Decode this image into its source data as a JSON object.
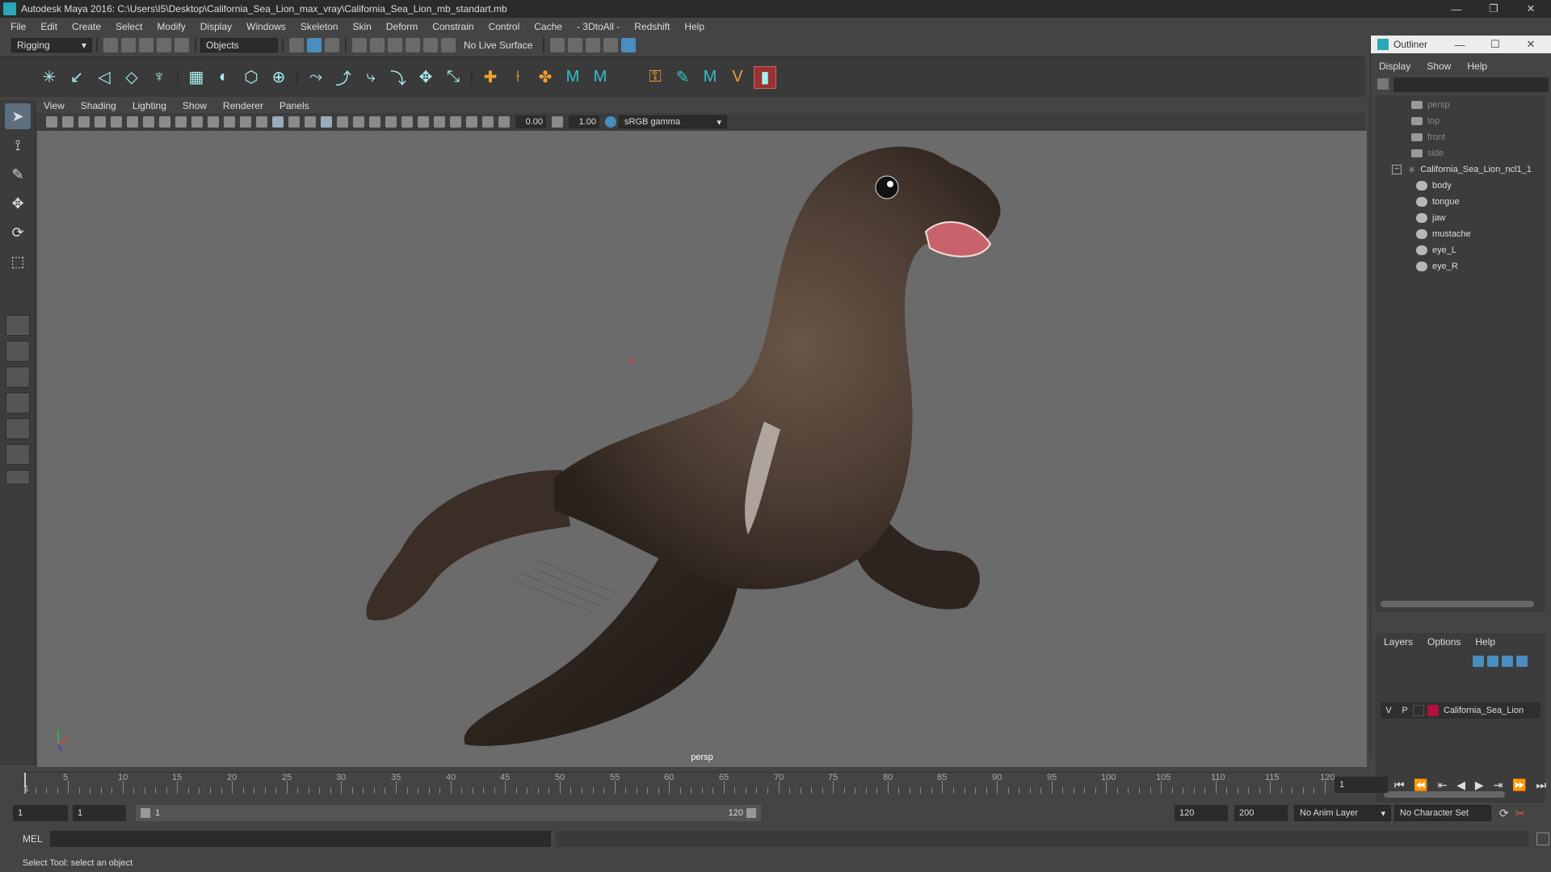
{
  "window": {
    "title": "Autodesk Maya 2016: C:\\Users\\I5\\Desktop\\California_Sea_Lion_max_vray\\California_Sea_Lion_mb_standart.mb"
  },
  "menubar": {
    "items": [
      "File",
      "Edit",
      "Create",
      "Select",
      "Modify",
      "Display",
      "Windows",
      "Skeleton",
      "Skin",
      "Deform",
      "Constrain",
      "Control",
      "Cache",
      "- 3DtoAll -",
      "Redshift",
      "Help"
    ]
  },
  "statusline": {
    "mode": "Rigging",
    "selection_mask": "Objects",
    "live_surface": "No Live Surface"
  },
  "viewport": {
    "menu": [
      "View",
      "Shading",
      "Lighting",
      "Show",
      "Renderer",
      "Panels"
    ],
    "exposure": "0.00",
    "gamma": "1.00",
    "color_space": "sRGB gamma",
    "camera_label": "persp"
  },
  "outliner": {
    "title": "Outliner",
    "menu": [
      "Display",
      "Show",
      "Help"
    ],
    "items": [
      {
        "label": "persp",
        "type": "camera"
      },
      {
        "label": "top",
        "type": "camera"
      },
      {
        "label": "front",
        "type": "camera"
      },
      {
        "label": "side",
        "type": "camera"
      },
      {
        "label": "California_Sea_Lion_ncl1_1",
        "type": "group"
      },
      {
        "label": "body",
        "type": "mesh"
      },
      {
        "label": "tongue",
        "type": "mesh"
      },
      {
        "label": "jaw",
        "type": "mesh"
      },
      {
        "label": "mustache",
        "type": "mesh"
      },
      {
        "label": "eye_L",
        "type": "mesh"
      },
      {
        "label": "eye_R",
        "type": "mesh"
      }
    ]
  },
  "layers": {
    "menu": [
      "Layers",
      "Options",
      "Help"
    ],
    "rows": [
      {
        "v": "V",
        "p": "P",
        "name": "California_Sea_Lion",
        "color": "#b0103a"
      }
    ]
  },
  "timeslider": {
    "ticks": [
      "5",
      "10",
      "15",
      "20",
      "25",
      "30",
      "35",
      "40",
      "45",
      "50",
      "55",
      "60",
      "65",
      "70",
      "75",
      "80",
      "85",
      "90",
      "95",
      "100",
      "105",
      "110",
      "115",
      "120"
    ],
    "start_label": "1",
    "current_frame": "1"
  },
  "range": {
    "start": "1",
    "playback_start": "1",
    "slider_start": "1",
    "slider_end": "120",
    "playback_end": "120",
    "end": "200",
    "anim_layer": "No Anim Layer",
    "character_set": "No Character Set"
  },
  "cmdline": {
    "label": "MEL"
  },
  "helpline": {
    "text": "Select Tool: select an object"
  }
}
